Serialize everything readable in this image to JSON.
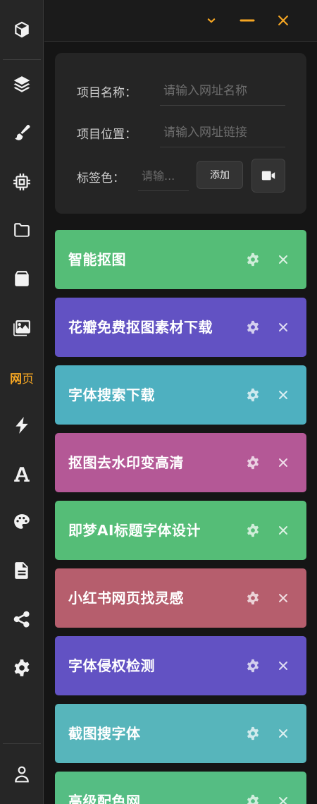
{
  "sidebar": {
    "items": [
      {
        "icon": "cube-icon"
      },
      {
        "icon": "layers-icon"
      },
      {
        "icon": "brush-icon"
      },
      {
        "icon": "chip-icon"
      },
      {
        "icon": "folder-icon"
      },
      {
        "icon": "archive-icon"
      },
      {
        "icon": "images-icon"
      },
      {
        "icon": "web-label",
        "label_bold": "网",
        "label_light": "页",
        "active": true
      },
      {
        "icon": "bolt-icon"
      },
      {
        "icon": "font-icon"
      },
      {
        "icon": "palette-icon"
      },
      {
        "icon": "document-icon"
      },
      {
        "icon": "share-icon"
      },
      {
        "icon": "gear-icon"
      },
      {
        "icon": "user-icon"
      }
    ],
    "active_color": "#f5a623"
  },
  "window_controls": {
    "icons": [
      "chevron-down-icon",
      "minimize-icon",
      "close-icon"
    ],
    "color": "#f5a623"
  },
  "form": {
    "name_label": "项目名称：",
    "name_placeholder": "请输入网址名称",
    "url_label": "项目位置：",
    "url_placeholder": "请输入网址链接",
    "color_label": "标签色：",
    "color_placeholder": "请输...",
    "add_label": "添加",
    "video_icon": "video-icon"
  },
  "cards": [
    {
      "title": "智能抠图",
      "color": "#55bd77"
    },
    {
      "title": "花瓣免费抠图素材下载",
      "color": "#6252c3"
    },
    {
      "title": "字体搜索下载",
      "color": "#4eb0c0"
    },
    {
      "title": "抠图去水印变高清",
      "color": "#b45896"
    },
    {
      "title": "即梦AI标题字体设计",
      "color": "#55bd77"
    },
    {
      "title": "小红书网页找灵感",
      "color": "#b65e6d"
    },
    {
      "title": "字体侵权检测",
      "color": "#6252c3"
    },
    {
      "title": "截图搜字体",
      "color": "#57b5bb"
    },
    {
      "title": "高级配色网",
      "color": "#55bd83"
    }
  ]
}
